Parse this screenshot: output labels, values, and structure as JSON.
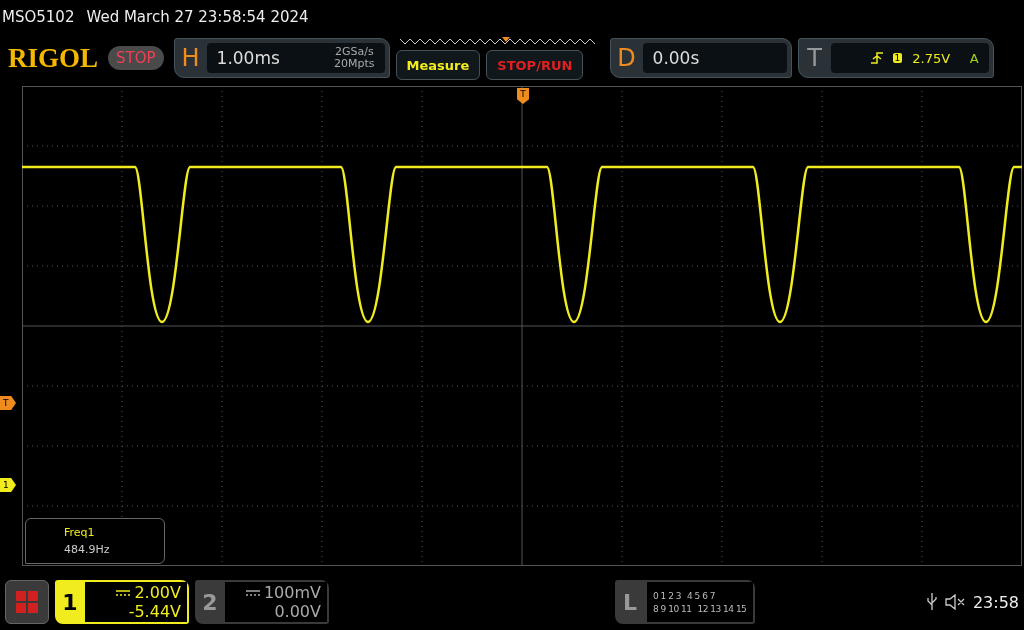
{
  "header": {
    "model": "MSO5102",
    "datetime": "Wed March 27 23:58:54 2024"
  },
  "toolbar": {
    "logo": "RIGOL",
    "run_state": {
      "label": "STOP",
      "kind": "stopped"
    },
    "horizontal": {
      "key": "H",
      "timebase": "1.00ms",
      "sample_rate": "2GSa/s",
      "memory_depth": "20Mpts"
    },
    "buttons": [
      {
        "label": "Measure",
        "kind": "measure"
      },
      {
        "label": "STOP/RUN",
        "kind": "run"
      }
    ],
    "delay": {
      "key": "D",
      "value": "0.00s"
    },
    "trigger": {
      "key": "T",
      "source": "1",
      "level": "2.75V",
      "mode": "A"
    }
  },
  "screen": {
    "trigger_position": "T",
    "markers": [
      {
        "label": "T",
        "kind": "trigger"
      },
      {
        "label": "1",
        "kind": "channel"
      }
    ],
    "measurement": {
      "name": "Freq1",
      "value": "484.9Hz"
    }
  },
  "bottom": {
    "channels": [
      {
        "number": "1",
        "scale": "2.00V",
        "offset": "-5.44V",
        "selected": true
      },
      {
        "number": "2",
        "scale": "100mV",
        "offset": "0.00V",
        "selected": false
      }
    ],
    "logic": {
      "key": "L",
      "rows": [
        [
          "0 1 2 3",
          "4 5 6 7"
        ],
        [
          "8 9 10 11",
          "12 13 14 15"
        ]
      ]
    },
    "clock": "23:58"
  }
}
